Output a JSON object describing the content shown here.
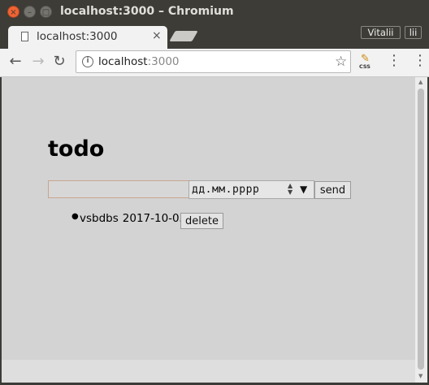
{
  "window": {
    "title": "localhost:3000 – Chromium",
    "controls": {
      "close": "×",
      "minimize": "–",
      "maximize": "□"
    },
    "profile_name": "Vitalii",
    "profile_short": "lii"
  },
  "tab": {
    "title": "localhost:3000",
    "close_glyph": "×"
  },
  "toolbar": {
    "back_glyph": "←",
    "forward_glyph": "→",
    "reload_glyph": "↻",
    "url_host": "localhost",
    "url_port": ":3000",
    "star_glyph": "☆",
    "extension_label": "CSS",
    "extension_glyph": "✎",
    "menu_glyph": "⋮"
  },
  "page": {
    "title": "todo",
    "input_value": "",
    "date_placeholder": "дд.мм.рррр",
    "send_label": "send",
    "items": [
      {
        "text": "vsbdbs",
        "date": "2017-10-05",
        "delete_label": "delete"
      }
    ]
  },
  "colors": {
    "titlebar": "#3d3c37",
    "close_button": "#f06333",
    "page_background": "#d3d3d3"
  }
}
